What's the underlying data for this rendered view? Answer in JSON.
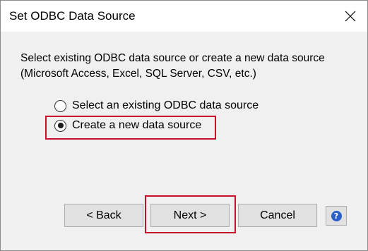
{
  "window": {
    "title": "Set ODBC Data Source"
  },
  "description": {
    "line1": "Select existing ODBC data source or create a new data source",
    "line2": "(Microsoft Access, Excel, SQL Server, CSV, etc.)"
  },
  "options": [
    {
      "label": "Select an existing ODBC data source",
      "selected": false
    },
    {
      "label": "Create a new data source",
      "selected": true
    }
  ],
  "buttons": {
    "back": "< Back",
    "next": "Next >",
    "cancel": "Cancel",
    "help": "?"
  },
  "icons": {
    "close": "close-icon",
    "help": "help-icon"
  },
  "colors": {
    "highlight": "#c8102e",
    "help_icon": "#2a5fc9",
    "dialog_bg": "#f0f0f0",
    "button_bg": "#e1e1e1"
  }
}
